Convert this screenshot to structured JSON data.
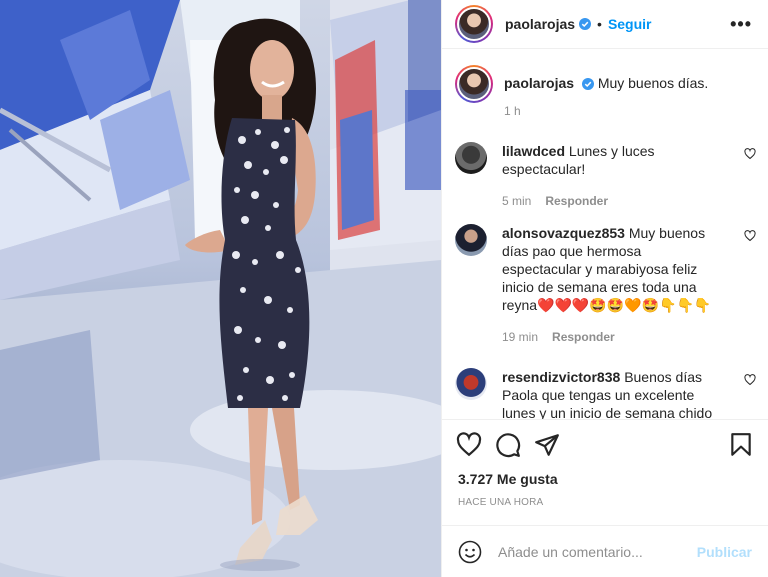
{
  "header": {
    "username": "paolarojas",
    "separator": "•",
    "follow_label": "Seguir",
    "more_label": "•••"
  },
  "caption": {
    "username": "paolarojas",
    "text": "Muy buenos días.",
    "age": "1 h"
  },
  "comments": [
    {
      "username": "lilawdced",
      "text": "Lunes y luces espectacular!",
      "age": "5 min",
      "reply_label": "Responder"
    },
    {
      "username": "alonsovazquez853",
      "text": "Muy buenos días pao que hermosa espectacular y marabiyosa feliz inicio de semana eres toda una reyna❤️❤️❤️🤩🤩🧡🤩👇👇👇",
      "age": "19 min",
      "reply_label": "Responder"
    },
    {
      "username": "resendizvictor838",
      "text": "Buenos días Paola que tengas un excelente lunes y un inicio de semana chido",
      "age": "",
      "reply_label": ""
    }
  ],
  "likes": "3.727 Me gusta",
  "posted": "HACE UNA HORA",
  "add_comment": {
    "placeholder": "Añade un comentario...",
    "publish_label": "Publicar"
  },
  "colors": {
    "accent": "#0095f6",
    "publish_disabled": "#b2dffc",
    "muted": "#8e8e8e",
    "text": "#262626"
  },
  "icons": [
    "verified-badge-icon",
    "heart-icon",
    "comment-icon",
    "share-icon",
    "bookmark-icon",
    "emoji-icon",
    "more-options-icon"
  ]
}
